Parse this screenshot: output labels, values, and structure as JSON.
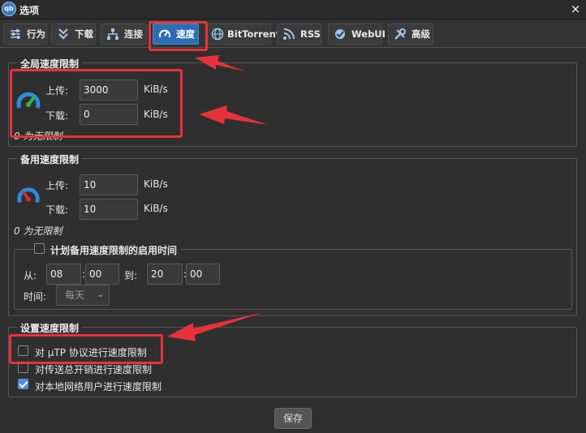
{
  "window": {
    "app_icon_text": "qb",
    "title": "选项",
    "close_glyph": "×"
  },
  "tabs": [
    {
      "label": "行为",
      "icon": "sliders-icon"
    },
    {
      "label": "下载",
      "icon": "download-icon"
    },
    {
      "label": "连接",
      "icon": "network-icon"
    },
    {
      "label": "速度",
      "icon": "speedometer-icon",
      "active": true
    },
    {
      "label": "BitTorrent",
      "icon": "globe-icon"
    },
    {
      "label": "RSS",
      "icon": "rss-icon"
    },
    {
      "label": "WebUI",
      "icon": "webui-icon"
    },
    {
      "label": "高级",
      "icon": "tools-icon"
    }
  ],
  "global_limits": {
    "legend": "全局速度限制",
    "upload_label": "上传:",
    "upload_value": "3000",
    "download_label": "下载:",
    "download_value": "0",
    "unit": "KiB/s",
    "note": "0 为无限制"
  },
  "alt_limits": {
    "legend": "备用速度限制",
    "upload_label": "上传:",
    "upload_value": "10",
    "download_label": "下载:",
    "download_value": "10",
    "unit": "KiB/s",
    "note": "0 为无限制",
    "schedule": {
      "legend": "计划备用速度限制的启用时间",
      "from_label": "从:",
      "from_hour": "08",
      "from_min": "00",
      "to_label": "到:",
      "to_hour": "20",
      "to_min": "00",
      "colon": ":",
      "time_label": "时间:",
      "days_value": "每天",
      "caret": "⌄"
    }
  },
  "settings": {
    "legend": "设置速度限制",
    "options": [
      {
        "label": "对 µTP 协议进行速度限制",
        "checked": false
      },
      {
        "label": "对传送总开销进行速度限制",
        "checked": false
      },
      {
        "label": "对本地网络用户进行速度限制",
        "checked": true
      }
    ]
  },
  "save_label": "保存",
  "colors": {
    "accent": "#2d6db4",
    "annotation": "#e8323a",
    "background": "#2f2f2f"
  }
}
